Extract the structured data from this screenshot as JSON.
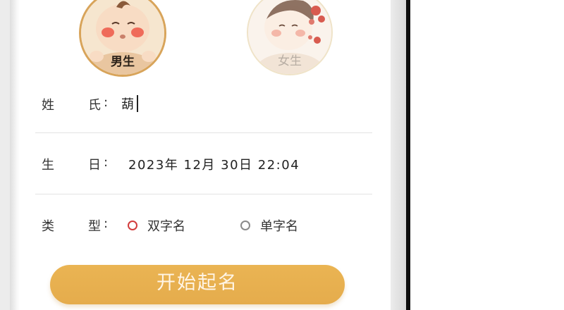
{
  "gender": {
    "boy_label": "男生",
    "girl_label": "女生",
    "selected": "男生"
  },
  "form": {
    "surname": {
      "label_chars": [
        "姓",
        "氏"
      ],
      "colon": ":",
      "value": "葫"
    },
    "birthday": {
      "label_chars": [
        "生",
        "日"
      ],
      "colon": ":",
      "value": "2023年 12月 30日  22:04"
    },
    "type": {
      "label_chars": [
        "类",
        "型"
      ],
      "colon": ":",
      "options": [
        "双字名",
        "单字名"
      ],
      "selected": "双字名"
    }
  },
  "start_button": {
    "label": "开始起名"
  },
  "colors": {
    "accent": "#E8B050",
    "radio_selected": "#D23C3C",
    "radio_unselected": "#8A8A8A",
    "boy_ring": "#D8A45A"
  },
  "icons": {
    "boy_avatar": "boy-cartoon-avatar-icon",
    "girl_avatar": "girl-cartoon-avatar-icon"
  }
}
